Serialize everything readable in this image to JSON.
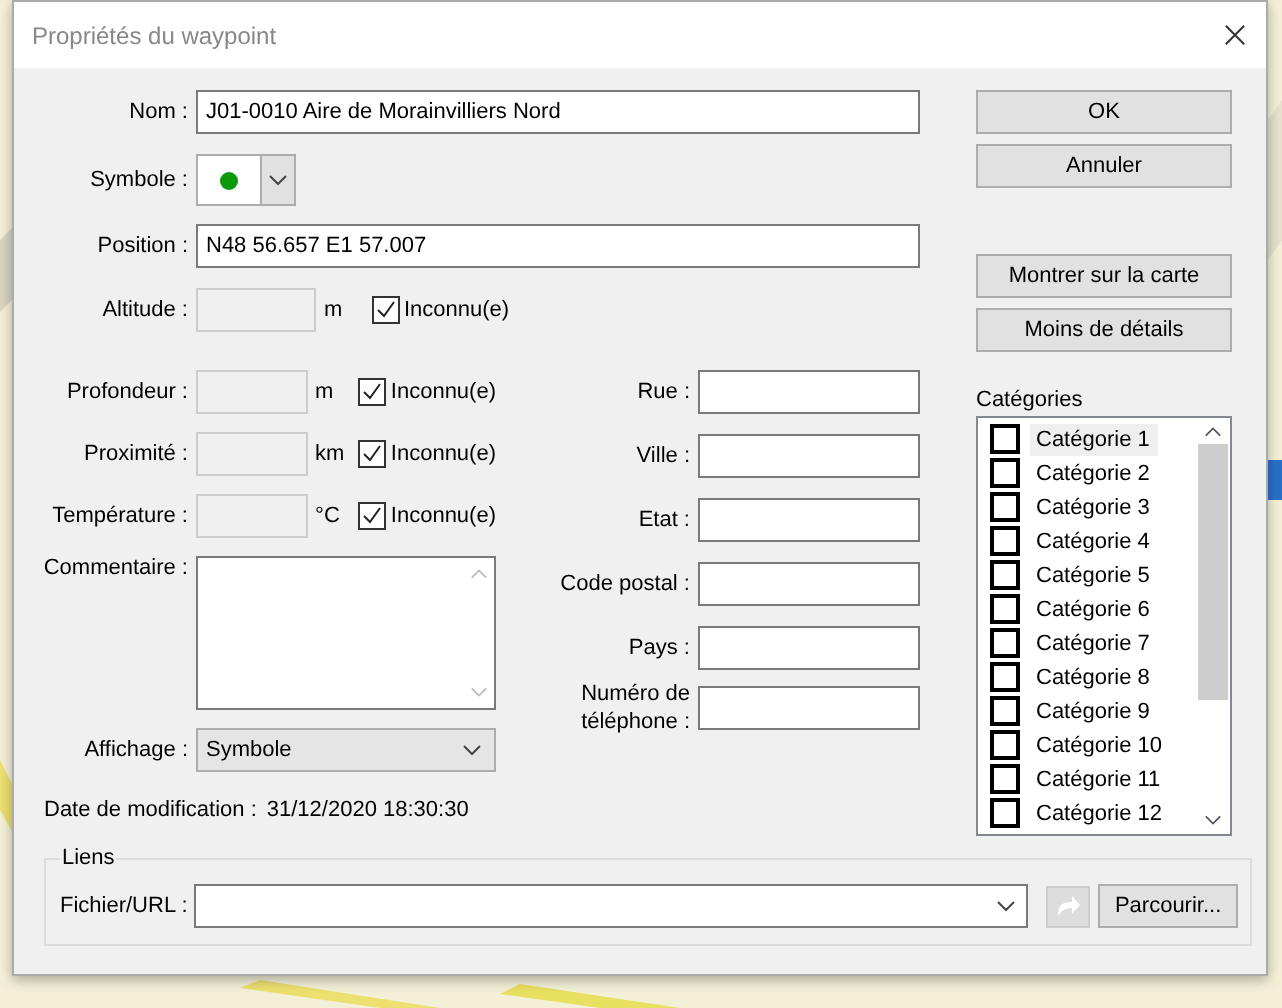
{
  "window": {
    "title": "Propriétés du waypoint"
  },
  "name": {
    "label": "Nom :",
    "value": "J01-0010 Aire de Morainvilliers Nord"
  },
  "symbol": {
    "label": "Symbole :"
  },
  "position": {
    "label": "Position :",
    "value": "N48 56.657 E1 57.007"
  },
  "altitude": {
    "label": "Altitude :",
    "unit": "m",
    "unknown_label": "Inconnu(e)",
    "checked": true
  },
  "measures": [
    {
      "label": "Profondeur :",
      "unit": "m",
      "unknown_label": "Inconnu(e)",
      "checked": true
    },
    {
      "label": "Proximité :",
      "unit": "km",
      "unknown_label": "Inconnu(e)",
      "checked": true
    },
    {
      "label": "Température :",
      "unit": "°C",
      "unknown_label": "Inconnu(e)",
      "checked": true
    }
  ],
  "comment": {
    "label": "Commentaire :"
  },
  "display": {
    "label": "Affichage :",
    "value": "Symbole"
  },
  "modified": {
    "label": "Date de modification :",
    "value": "31/12/2020 18:30:30"
  },
  "address": [
    {
      "label": "Rue :"
    },
    {
      "label": "Ville :"
    },
    {
      "label": "Etat :"
    },
    {
      "label": "Code postal :"
    },
    {
      "label": "Pays :"
    },
    {
      "label": "Numéro de\ntéléphone :"
    }
  ],
  "buttons": [
    "OK",
    "Annuler"
  ],
  "map_buttons": [
    "Montrer sur la carte",
    "Moins de détails"
  ],
  "categories": {
    "label": "Catégories",
    "items": [
      {
        "label": "Catégorie 1",
        "checked": false,
        "selected": true
      },
      {
        "label": "Catégorie 2",
        "checked": false,
        "selected": false
      },
      {
        "label": "Catégorie 3",
        "checked": false,
        "selected": false
      },
      {
        "label": "Catégorie 4",
        "checked": false,
        "selected": false
      },
      {
        "label": "Catégorie 5",
        "checked": false,
        "selected": false
      },
      {
        "label": "Catégorie 6",
        "checked": false,
        "selected": false
      },
      {
        "label": "Catégorie 7",
        "checked": false,
        "selected": false
      },
      {
        "label": "Catégorie 8",
        "checked": false,
        "selected": false
      },
      {
        "label": "Catégorie 9",
        "checked": false,
        "selected": false
      },
      {
        "label": "Catégorie 10",
        "checked": false,
        "selected": false
      },
      {
        "label": "Catégorie 11",
        "checked": false,
        "selected": false
      },
      {
        "label": "Catégorie 12",
        "checked": false,
        "selected": false
      }
    ]
  },
  "links": {
    "title": "Liens",
    "label": "Fichier/URL :",
    "browse": "Parcourir..."
  }
}
